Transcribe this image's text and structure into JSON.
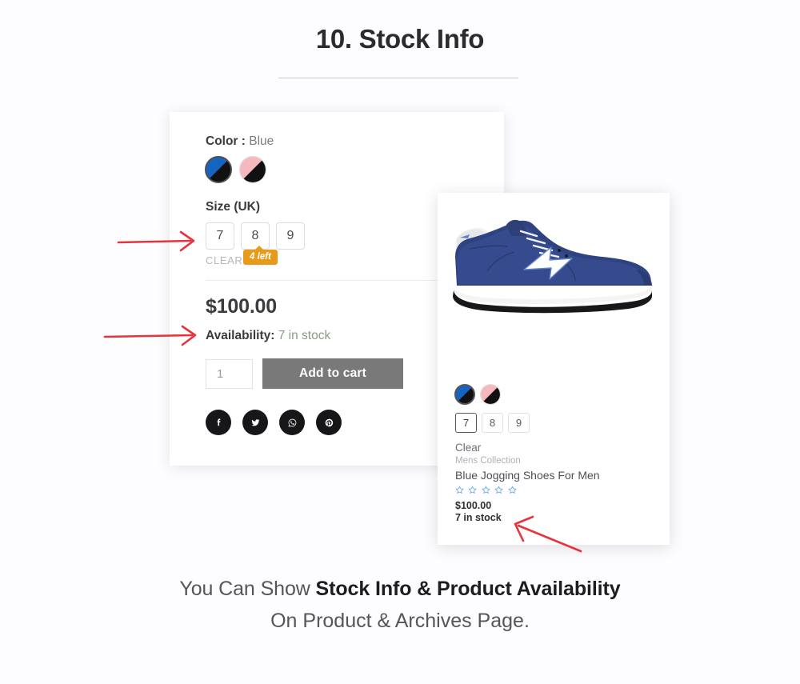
{
  "heading": {
    "title": "10. Stock Info"
  },
  "product_card": {
    "color_attr": {
      "label": "Color",
      "separator": ":",
      "value": "Blue"
    },
    "color_swatches": [
      {
        "name": "blue",
        "selected": true
      },
      {
        "name": "pink",
        "selected": false
      }
    ],
    "size_attr": {
      "label": "Size (UK)"
    },
    "sizes": [
      "7",
      "8",
      "9"
    ],
    "stock_tooltip": "4 left",
    "clear_label": "CLEAR",
    "price": "$100.00",
    "availability": {
      "label": "Availability:",
      "value": "7 in stock"
    },
    "quantity": "1",
    "add_to_cart_label": "Add to cart",
    "social": [
      {
        "icon": "facebook-icon",
        "name": "Facebook"
      },
      {
        "icon": "twitter-icon",
        "name": "Twitter"
      },
      {
        "icon": "whatsapp-icon",
        "name": "WhatsApp"
      },
      {
        "icon": "pinterest-icon",
        "name": "Pinterest"
      }
    ]
  },
  "archive_card": {
    "product_image_alt": "Blue suede jogging sneaker, side view",
    "color_swatches": [
      {
        "name": "blue",
        "selected": true
      },
      {
        "name": "pink",
        "selected": false
      }
    ],
    "sizes": [
      "7",
      "8",
      "9"
    ],
    "selected_size": "7",
    "clear_label": "Clear",
    "category": "Mens Collection",
    "title": "Blue Jogging Shoes For Men",
    "rating_stars": 0,
    "rating_max": 5,
    "price": "$100.00",
    "stock": "7 in stock"
  },
  "caption": {
    "line1_prefix": "You Can Show ",
    "line1_bold": "Stock Info & Product Availability",
    "line2": "On Product & Archives Page."
  },
  "colors": {
    "page_background": "#fdfcfe",
    "accent_orange": "#e89a19",
    "arrow_red": "#e8323c",
    "button_grey": "#797979",
    "swatch_blue": "#1565c0",
    "swatch_pink": "#f6b8bd",
    "star_blue": "#6aa7e0"
  }
}
